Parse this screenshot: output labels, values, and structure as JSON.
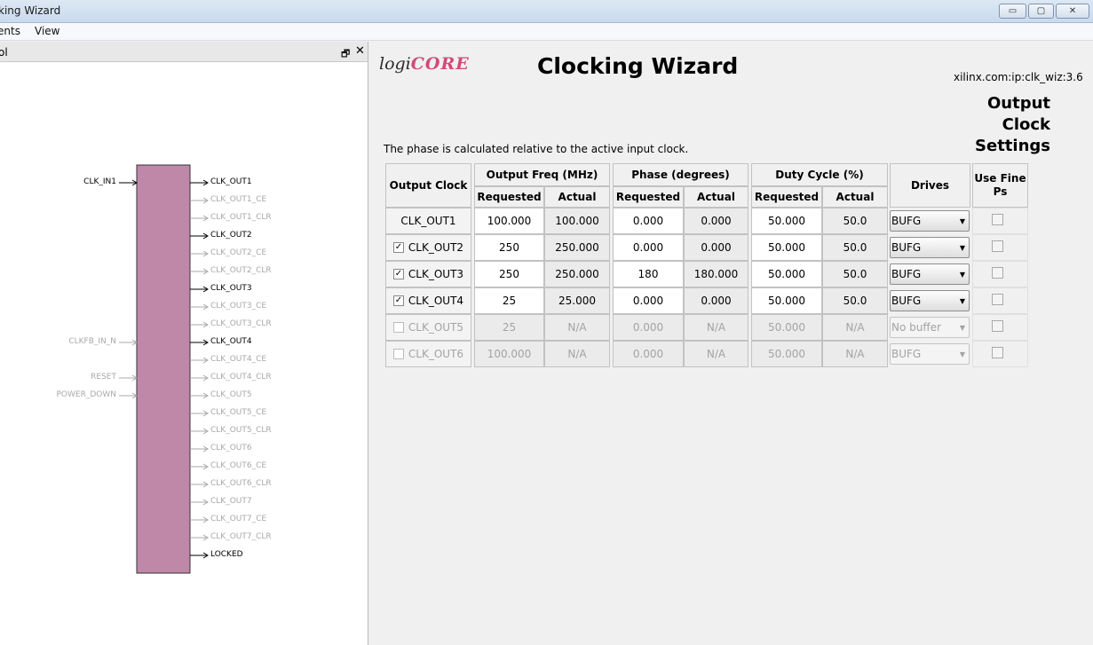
{
  "window": {
    "title": "king Wizard",
    "min_glyph": "▭",
    "max_glyph": "▢",
    "close_glyph": "✕"
  },
  "menu": [
    "ents",
    "View"
  ],
  "left_panel": {
    "title": "ol",
    "restore_glyph": "🗗",
    "close_glyph": "✕",
    "block_color": "#bf88a8",
    "input_pins": [
      {
        "name": "CLK_IN1",
        "active": true
      },
      {
        "name": "CLKFB_IN_N",
        "active": false
      },
      {
        "name": "RESET",
        "active": false
      },
      {
        "name": "POWER_DOWN",
        "active": false
      }
    ],
    "output_pins": [
      {
        "name": "CLK_OUT1",
        "active": true
      },
      {
        "name": "CLK_OUT1_CE",
        "active": false
      },
      {
        "name": "CLK_OUT1_CLR",
        "active": false
      },
      {
        "name": "CLK_OUT2",
        "active": true
      },
      {
        "name": "CLK_OUT2_CE",
        "active": false
      },
      {
        "name": "CLK_OUT2_CLR",
        "active": false
      },
      {
        "name": "CLK_OUT3",
        "active": true
      },
      {
        "name": "CLK_OUT3_CE",
        "active": false
      },
      {
        "name": "CLK_OUT3_CLR",
        "active": false
      },
      {
        "name": "CLK_OUT4",
        "active": true
      },
      {
        "name": "CLK_OUT4_CE",
        "active": false
      },
      {
        "name": "CLK_OUT4_CLR",
        "active": false
      },
      {
        "name": "CLK_OUT5",
        "active": false
      },
      {
        "name": "CLK_OUT5_CE",
        "active": false
      },
      {
        "name": "CLK_OUT5_CLR",
        "active": false
      },
      {
        "name": "CLK_OUT6",
        "active": false
      },
      {
        "name": "CLK_OUT6_CE",
        "active": false
      },
      {
        "name": "CLK_OUT6_CLR",
        "active": false
      },
      {
        "name": "CLK_OUT7",
        "active": false
      },
      {
        "name": "CLK_OUT7_CE",
        "active": false
      },
      {
        "name": "CLK_OUT7_CLR",
        "active": false
      },
      {
        "name": "LOCKED",
        "active": true
      }
    ]
  },
  "header": {
    "logo_part1": "logi",
    "logo_part2": "CORE",
    "title": "Clocking Wizard",
    "ip_id": "xilinx.com:ip:clk_wiz:3.6",
    "section_title": "Output Clock Settings",
    "phase_note": "The phase is calculated relative to the active input clock."
  },
  "table": {
    "headers": {
      "output_clock": "Output Clock",
      "output_freq": "Output Freq (MHz)",
      "phase": "Phase (degrees)",
      "duty_cycle": "Duty Cycle (%)",
      "drives": "Drives",
      "use_fine_ps": "Use Fine Ps",
      "requested": "Requested",
      "actual": "Actual"
    },
    "rows": [
      {
        "name": "CLK_OUT1",
        "has_checkbox": false,
        "checked": true,
        "enabled": true,
        "freq_req": "100.000",
        "freq_act": "100.000",
        "phase_req": "0.000",
        "phase_act": "0.000",
        "duty_req": "50.000",
        "duty_act": "50.0",
        "drives": "BUFG"
      },
      {
        "name": "CLK_OUT2",
        "has_checkbox": true,
        "checked": true,
        "enabled": true,
        "freq_req": "250",
        "freq_act": "250.000",
        "phase_req": "0.000",
        "phase_act": "0.000",
        "duty_req": "50.000",
        "duty_act": "50.0",
        "drives": "BUFG"
      },
      {
        "name": "CLK_OUT3",
        "has_checkbox": true,
        "checked": true,
        "enabled": true,
        "freq_req": "250",
        "freq_act": "250.000",
        "phase_req": "180",
        "phase_act": "180.000",
        "duty_req": "50.000",
        "duty_act": "50.0",
        "drives": "BUFG"
      },
      {
        "name": "CLK_OUT4",
        "has_checkbox": true,
        "checked": true,
        "enabled": true,
        "freq_req": "25",
        "freq_act": "25.000",
        "phase_req": "0.000",
        "phase_act": "0.000",
        "duty_req": "50.000",
        "duty_act": "50.0",
        "drives": "BUFG"
      },
      {
        "name": "CLK_OUT5",
        "has_checkbox": true,
        "checked": false,
        "enabled": false,
        "freq_req": "25",
        "freq_act": "N/A",
        "phase_req": "0.000",
        "phase_act": "N/A",
        "duty_req": "50.000",
        "duty_act": "N/A",
        "drives": "No buffer"
      },
      {
        "name": "CLK_OUT6",
        "has_checkbox": true,
        "checked": false,
        "enabled": false,
        "freq_req": "100.000",
        "freq_act": "N/A",
        "phase_req": "0.000",
        "phase_act": "N/A",
        "duty_req": "50.000",
        "duty_act": "N/A",
        "drives": "BUFG"
      }
    ]
  }
}
